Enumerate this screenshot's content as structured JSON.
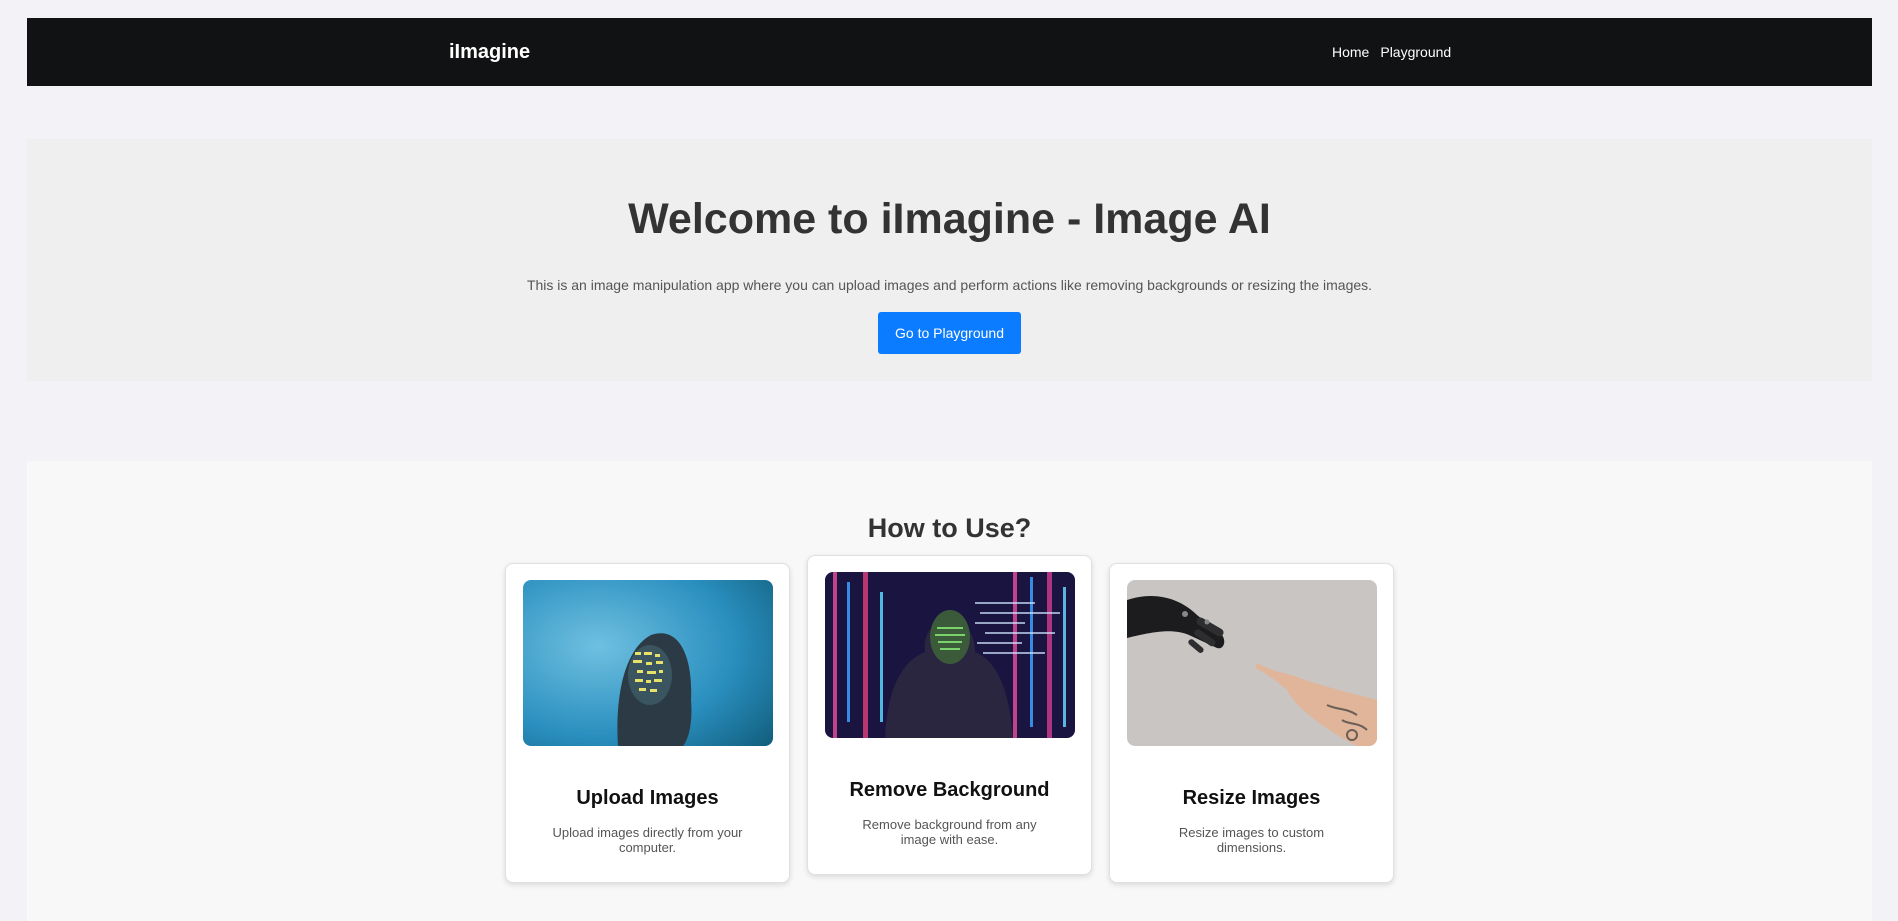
{
  "nav": {
    "brand": "iImagine",
    "links": [
      "Home",
      "Playground"
    ]
  },
  "hero": {
    "title": "Welcome to iImagine - Image AI",
    "description": "This is an image manipulation app where you can upload images and perform actions like removing backgrounds or resizing the images.",
    "button_label": "Go to Playground"
  },
  "how_to_use": {
    "title": "How to Use?",
    "cards": [
      {
        "title": "Upload Images",
        "description": "Upload images directly from your computer."
      },
      {
        "title": "Remove Background",
        "description": "Remove background from any image with ease."
      },
      {
        "title": "Resize Images",
        "description": "Resize images to custom dimensions."
      }
    ]
  },
  "colors": {
    "navbar": "#111213",
    "accent_button": "#0b7bff",
    "page_background": "#f3f3f7",
    "hero_background": "#efefef"
  }
}
